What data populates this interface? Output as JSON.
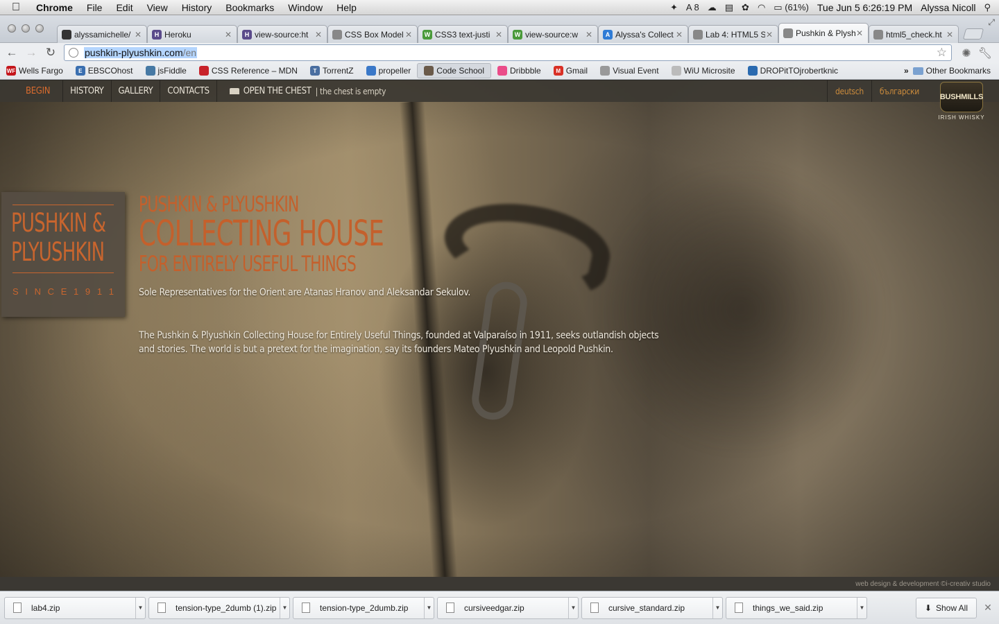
{
  "menubar": {
    "apple": "",
    "items": [
      "Chrome",
      "File",
      "Edit",
      "View",
      "History",
      "Bookmarks",
      "Window",
      "Help"
    ],
    "status": {
      "adobe_count": "8",
      "battery": "(61%)",
      "datetime": "Tue Jun 5  6:26:19 PM",
      "user": "Alyssa Nicoll"
    }
  },
  "tabs": [
    {
      "title": "alyssamichelle/",
      "icon": "github-icon",
      "color": "#333333",
      "glyph": ""
    },
    {
      "title": "Heroku",
      "icon": "heroku-icon",
      "color": "#5a4a8a",
      "glyph": "H"
    },
    {
      "title": "view-source:ht",
      "icon": "heroku-icon",
      "color": "#5a4a8a",
      "glyph": "H"
    },
    {
      "title": "CSS Box Model",
      "icon": "globe-icon",
      "color": "#888888",
      "glyph": ""
    },
    {
      "title": "CSS3 text-justi",
      "icon": "w3-icon",
      "color": "#4a9a3a",
      "glyph": "W"
    },
    {
      "title": "view-source:w",
      "icon": "w3-icon",
      "color": "#4a9a3a",
      "glyph": "W"
    },
    {
      "title": "Alyssa's Collect",
      "icon": "app-icon",
      "color": "#2f7cd6",
      "glyph": "A"
    },
    {
      "title": "Lab 4: HTML5 S",
      "icon": "globe-icon",
      "color": "#888888",
      "glyph": ""
    },
    {
      "title": "Pushkin & Plysh",
      "icon": "globe-icon",
      "color": "#888888",
      "glyph": "",
      "active": true
    },
    {
      "title": "html5_check.ht",
      "icon": "globe-icon",
      "color": "#888888",
      "glyph": ""
    }
  ],
  "toolbar": {
    "url_main": "pushkin-plyushkin.com",
    "url_path": "/en"
  },
  "bookmarks": [
    {
      "label": "Wells Fargo",
      "icon": "wells-fargo-icon",
      "color": "#c4161c",
      "glyph": "WF"
    },
    {
      "label": "EBSCOhost",
      "icon": "ebsco-icon",
      "color": "#3a6fb0",
      "glyph": "E"
    },
    {
      "label": "jsFiddle",
      "icon": "jsfiddle-icon",
      "color": "#4679a4",
      "glyph": ""
    },
    {
      "label": "CSS Reference – MDN",
      "icon": "mdn-icon",
      "color": "#c8222a",
      "glyph": ""
    },
    {
      "label": "TorrentZ",
      "icon": "torrentz-icon",
      "color": "#4a6ea0",
      "glyph": "T"
    },
    {
      "label": "propeller",
      "icon": "propeller-icon",
      "color": "#3a78c8",
      "glyph": ""
    },
    {
      "label": "Code School",
      "icon": "code-school-icon",
      "color": "#6a5a4a",
      "glyph": "",
      "selected": true
    },
    {
      "label": "Dribbble",
      "icon": "dribbble-icon",
      "color": "#ea4c89",
      "glyph": ""
    },
    {
      "label": "Gmail",
      "icon": "gmail-icon",
      "color": "#d93025",
      "glyph": "M"
    },
    {
      "label": "Visual Event",
      "icon": "globe-icon",
      "color": "#999999",
      "glyph": ""
    },
    {
      "label": "WiU Microsite",
      "icon": "page-icon",
      "color": "#bbbbbb",
      "glyph": ""
    },
    {
      "label": "DROPitTOjrobertknic",
      "icon": "drop-icon",
      "color": "#2a6ab0",
      "glyph": ""
    }
  ],
  "bookmarks_more": "»",
  "bookmarks_other": "Other Bookmarks",
  "site": {
    "nav": [
      "BEGIN",
      "HISTORY",
      "GALLERY",
      "CONTACTS"
    ],
    "chest_label": "OPEN THE CHEST",
    "chest_status": "| the chest is empty",
    "lang_de": "deutsch",
    "lang_bg": "български",
    "sponsor_name": "BUSHMILLS",
    "sponsor_sub": "IRISH WHISKY",
    "logo_line1": "PUSHKIN &",
    "logo_line2": "PLYUSHKIN",
    "logo_since": [
      "S",
      "I",
      "N",
      "C",
      "E",
      "1",
      "9",
      "1",
      "1"
    ],
    "headline_1": "Pushkin & Plyushkin",
    "headline_2": "Collecting House",
    "headline_3": "for Entirely Useful Things",
    "tagline": "Sole Representatives for the Orient are Atanas Hranov and Aleksandar Sekulov.",
    "intro": "The Pushkin & Plyushkin Collecting House for Entirely Useful Things, founded at Valparaíso in 1911, seeks outlandish objects and stories. The world is but a pretext for the imagination, say its founders Mateo Plyushkin and Leopold Pushkin.",
    "credit": "web design & development ©i-creativ studio"
  },
  "downloads": [
    "lab4.zip",
    "tension-type_2dumb (1).zip",
    "tension-type_2dumb.zip",
    "cursiveedgar.zip",
    "cursive_standard.zip",
    "things_we_said.zip"
  ],
  "downloads_show_all": "Show All",
  "colors": {
    "accent_orange": "#c4602c",
    "nav_bar": "#3c3832",
    "page_text": "#efe9dd"
  }
}
